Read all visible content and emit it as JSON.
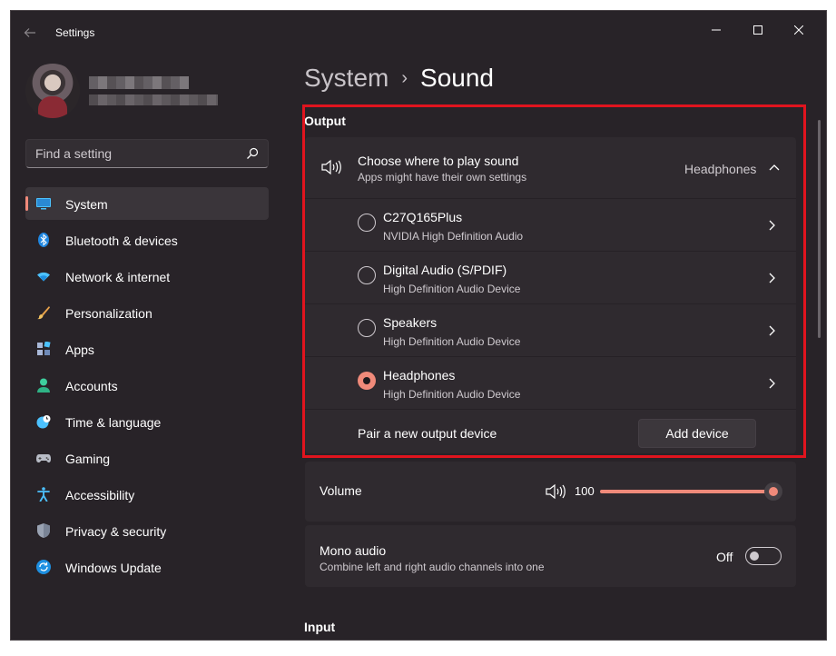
{
  "window": {
    "title": "Settings"
  },
  "search": {
    "placeholder": "Find a setting"
  },
  "sidebar": {
    "items": [
      {
        "label": "System",
        "icon": "monitor-icon",
        "active": true
      },
      {
        "label": "Bluetooth & devices",
        "icon": "bluetooth-icon"
      },
      {
        "label": "Network & internet",
        "icon": "wifi-icon"
      },
      {
        "label": "Personalization",
        "icon": "brush-icon"
      },
      {
        "label": "Apps",
        "icon": "apps-icon"
      },
      {
        "label": "Accounts",
        "icon": "person-icon"
      },
      {
        "label": "Time & language",
        "icon": "clock-globe-icon"
      },
      {
        "label": "Gaming",
        "icon": "gamepad-icon"
      },
      {
        "label": "Accessibility",
        "icon": "accessibility-icon"
      },
      {
        "label": "Privacy & security",
        "icon": "shield-icon"
      },
      {
        "label": "Windows Update",
        "icon": "update-icon"
      }
    ]
  },
  "breadcrumb": {
    "parent": "System",
    "separator": "›",
    "current": "Sound"
  },
  "output": {
    "section_label": "Output",
    "chooser": {
      "title": "Choose where to play sound",
      "subtitle": "Apps might have their own settings",
      "selected": "Headphones"
    },
    "devices": [
      {
        "name": "C27Q165Plus",
        "driver": "NVIDIA High Definition Audio",
        "checked": false
      },
      {
        "name": "Digital Audio (S/PDIF)",
        "driver": "High Definition Audio Device",
        "checked": false
      },
      {
        "name": "Speakers",
        "driver": "High Definition Audio Device",
        "checked": false
      },
      {
        "name": "Headphones",
        "driver": "High Definition Audio Device",
        "checked": true
      }
    ],
    "pair": {
      "label": "Pair a new output device",
      "button": "Add device"
    }
  },
  "volume": {
    "label": "Volume",
    "value": "100",
    "level": 1.0
  },
  "mono": {
    "title": "Mono audio",
    "subtitle": "Combine left and right audio channels into one",
    "state": "Off"
  },
  "input": {
    "section_label": "Input"
  },
  "colors": {
    "accent": "#f08a7a",
    "highlight_border": "#e0141e",
    "window_bg": "#282328",
    "card_bg": "#2f2a2f"
  }
}
